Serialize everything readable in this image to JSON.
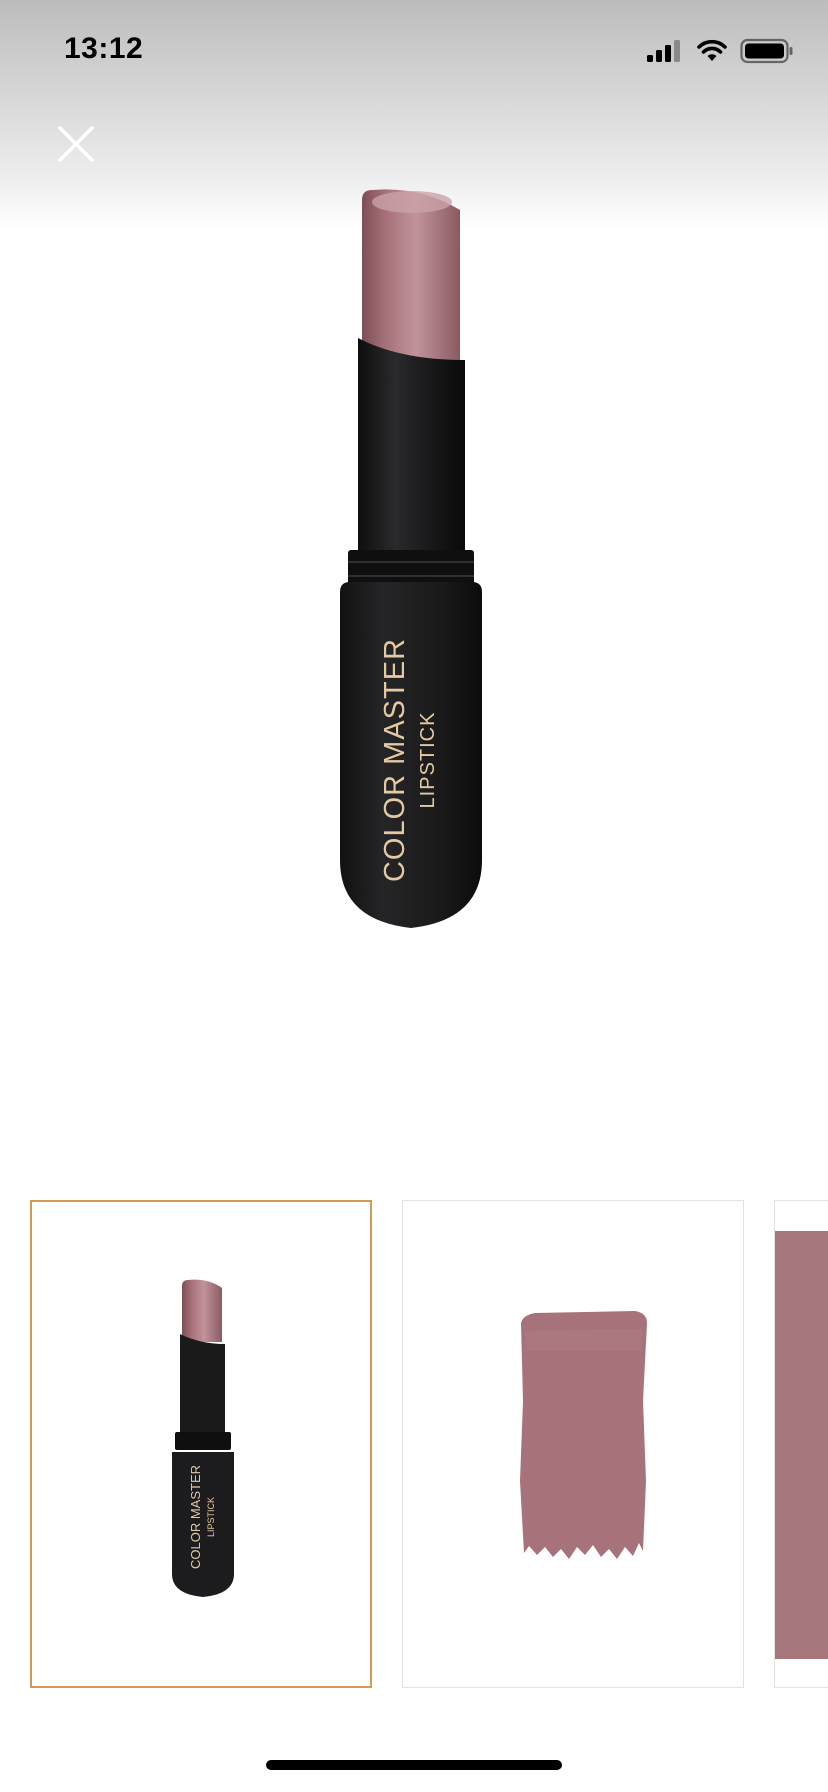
{
  "status_bar": {
    "time": "13:12"
  },
  "product": {
    "brand_text": "COLOR MASTER",
    "type_text": "LIPSTICK",
    "shade_color": "#a8727a",
    "case_color": "#1c1c1e",
    "label_color": "#e4c9a3"
  },
  "gallery": {
    "selected_border_color": "#d39a57",
    "items": [
      {
        "kind": "product-photo",
        "selected": true
      },
      {
        "kind": "swatch",
        "selected": false
      },
      {
        "kind": "texture",
        "selected": false
      }
    ]
  }
}
